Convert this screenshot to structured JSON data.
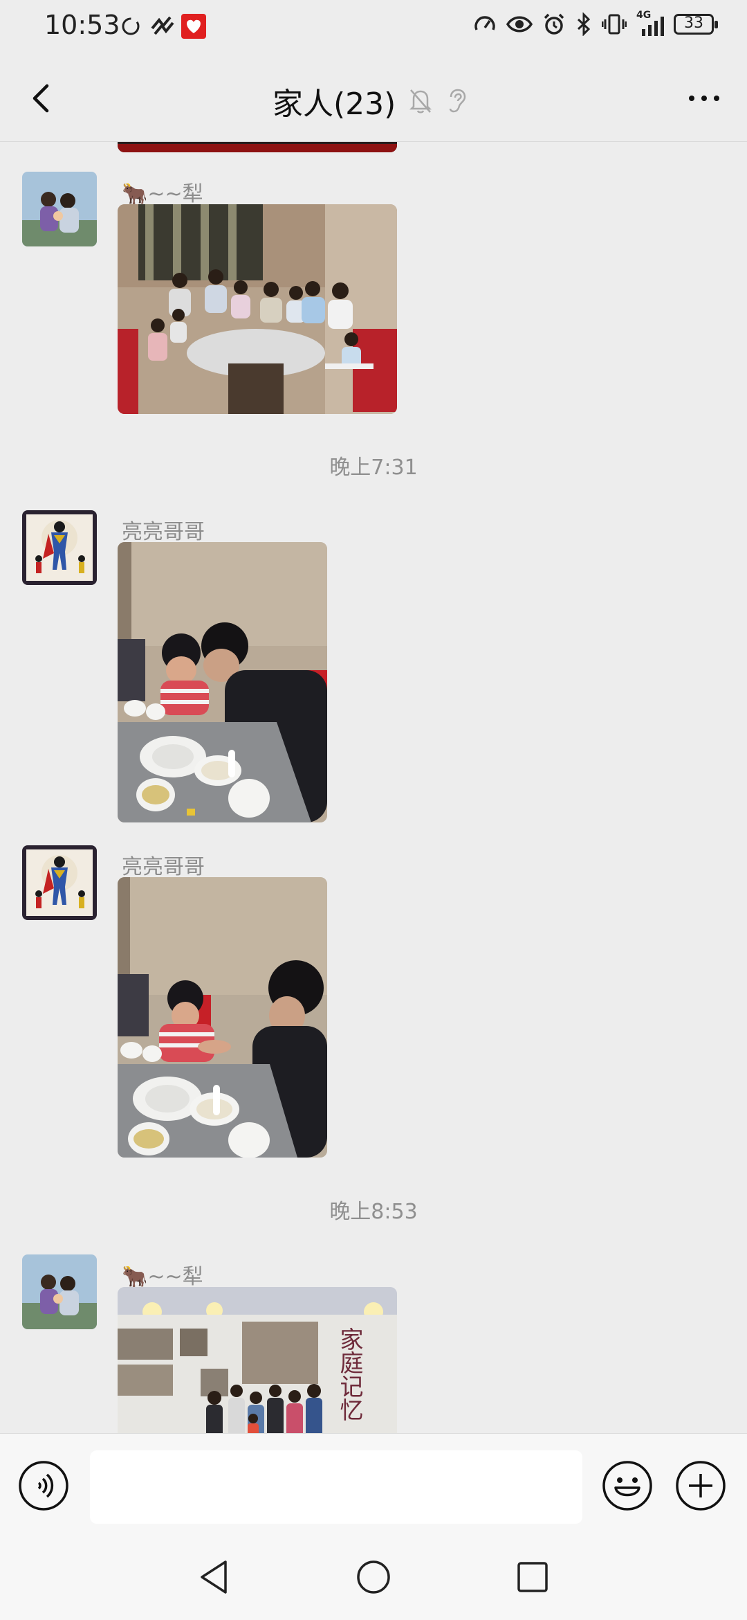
{
  "status": {
    "time": "10:53",
    "network": "4G",
    "battery": "33"
  },
  "header": {
    "title": "家人(23)"
  },
  "messages": [
    {
      "type": "photo",
      "sender": "🐂~~犁",
      "photo_desc": "family dinner group photo"
    },
    {
      "type": "timestamp",
      "text": "晚上7:31"
    },
    {
      "type": "photo",
      "sender": "亮亮哥哥",
      "photo_desc": "two boys at table"
    },
    {
      "type": "photo",
      "sender": "亮亮哥哥",
      "photo_desc": "two boys at table"
    },
    {
      "type": "timestamp",
      "text": "晚上8:53"
    },
    {
      "type": "photo",
      "sender": "🐂~~犁",
      "photo_desc": "family memory wall"
    }
  ],
  "exhibit": {
    "title": "家庭记忆"
  },
  "input": {
    "placeholder": ""
  },
  "colors": {
    "background": "#ededed",
    "text_secondary": "#8c8c8c",
    "accent_red": "#e02020"
  }
}
